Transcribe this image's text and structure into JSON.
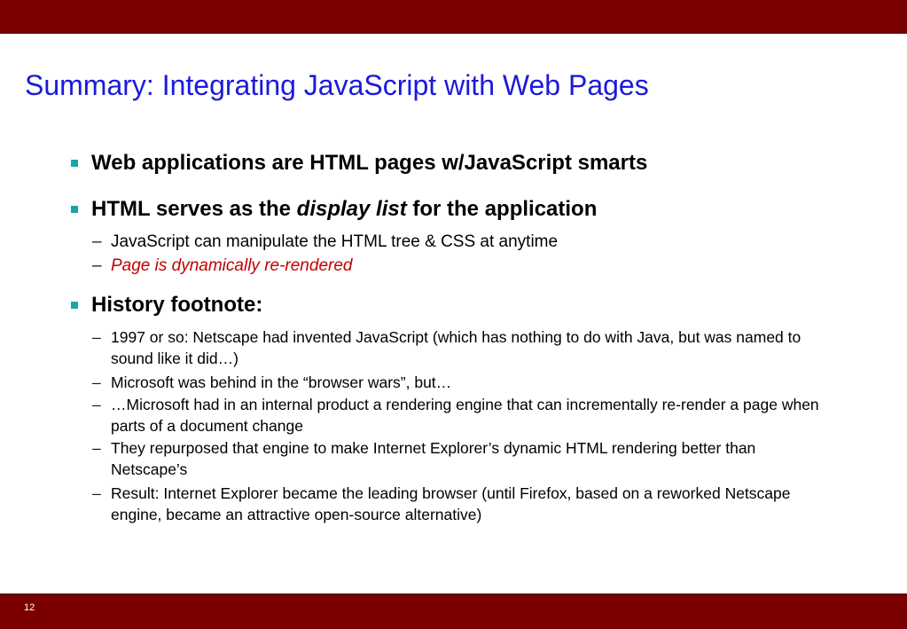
{
  "slide": {
    "title": "Summary: Integrating JavaScript with Web Pages",
    "page_number": "12"
  },
  "bullets": [
    {
      "text": "Web applications are HTML pages w/JavaScript smarts"
    },
    {
      "text_before": "HTML serves as the ",
      "text_emphasis": "display list",
      "text_after": " for the application",
      "subs": [
        "JavaScript can manipulate the HTML tree & CSS at anytime",
        "Page is dynamically re-rendered"
      ]
    },
    {
      "text": "History footnote:",
      "subs": [
        "1997 or so: Netscape had invented JavaScript (which has nothing to do with Java, but was named to sound like it did…)",
        "Microsoft was behind in the “browser wars”, but…",
        "…Microsoft had in an internal product a rendering engine that can incrementally re-render a page when parts of a document change",
        "They repurposed that engine to make Internet Explorer’s dynamic HTML rendering better than Netscape’s",
        "Result: Internet Explorer became the leading browser (until Firefox, based on a reworked Netscape engine, became an attractive open-source alternative)"
      ]
    }
  ],
  "dash_glyph": "–",
  "colors": {
    "bar": "#7a0000",
    "title": "#1a1adc",
    "bullet_marker": "#17a6a6",
    "highlight": "#c00000"
  }
}
